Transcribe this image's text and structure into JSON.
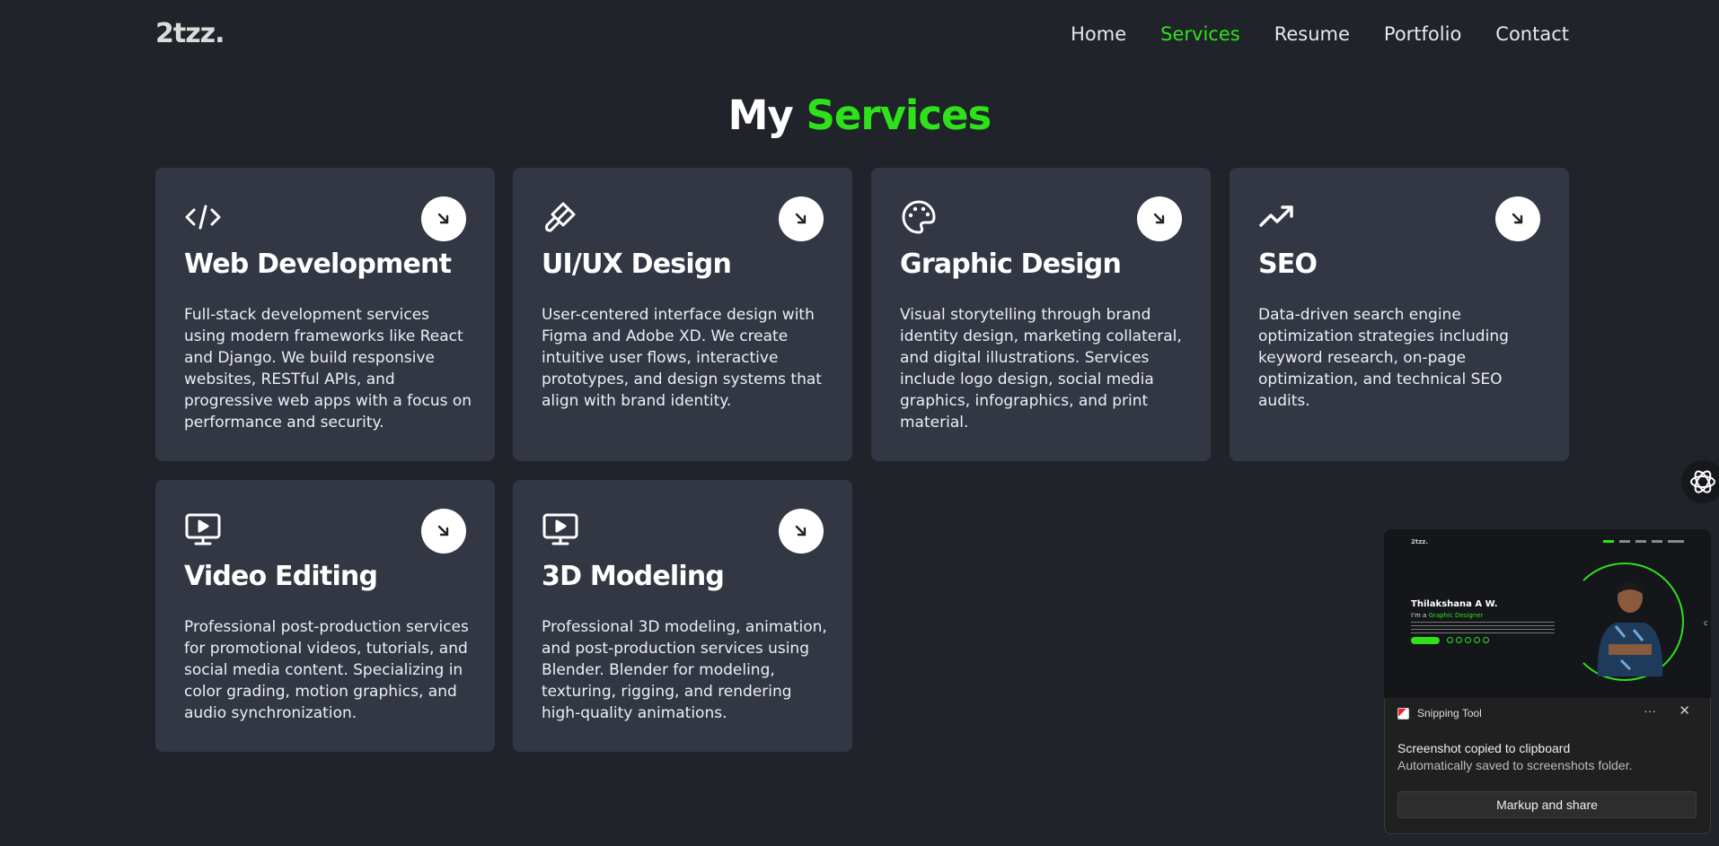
{
  "brand": {
    "logo": "2tzz.",
    "accent_color": "#2ee21a"
  },
  "nav": [
    {
      "label": "Home",
      "active": false
    },
    {
      "label": "Services",
      "active": true
    },
    {
      "label": "Resume",
      "active": false
    },
    {
      "label": "Portfolio",
      "active": false
    },
    {
      "label": "Contact",
      "active": false
    }
  ],
  "heading": {
    "prefix": "My",
    "accent": "Services"
  },
  "services": [
    {
      "icon": "code-icon",
      "title": "Web Development",
      "description": "Full-stack development services using modern frameworks like React and Django. We build responsive websites, RESTful APIs, and progressive web apps with a focus on performance and security."
    },
    {
      "icon": "paint-brush-icon",
      "title": "UI/UX Design",
      "description": "User-centered interface design with Figma and Adobe XD. We create intuitive user flows, interactive prototypes, and design systems that align with brand identity."
    },
    {
      "icon": "palette-icon",
      "title": "Graphic Design",
      "description": "Visual storytelling through brand identity design, marketing collateral, and digital illustrations. Services include logo design, social media graphics, infographics, and print material."
    },
    {
      "icon": "trending-up-icon",
      "title": "SEO",
      "description": "Data-driven search engine optimization strategies including keyword research, on-page optimization, and technical SEO audits."
    },
    {
      "icon": "monitor-play-icon",
      "title": "Video Editing",
      "description": "Professional post-production services for promotional videos, tutorials, and social media content. Specializing in color grading, motion graphics, and audio synchronization."
    },
    {
      "icon": "monitor-play-icon",
      "title": "3D Modeling",
      "description": "Professional 3D modeling, animation, and post-production services using Blender. Blender for modeling, texturing, rigging, and rendering high-quality animations."
    }
  ],
  "screenshot_preview": {
    "logo": "2tzz.",
    "name": "Thilakshana A W.",
    "subtitle_prefix": "I'm a",
    "subtitle_accent": "Graphic Designer",
    "edge_char": "c"
  },
  "toast": {
    "app_name": "Snipping Tool",
    "more_label": "···",
    "close_label": "✕",
    "title": "Screenshot copied to clipboard",
    "body": "Automatically saved to screenshots folder.",
    "button_label": "Markup and share"
  }
}
